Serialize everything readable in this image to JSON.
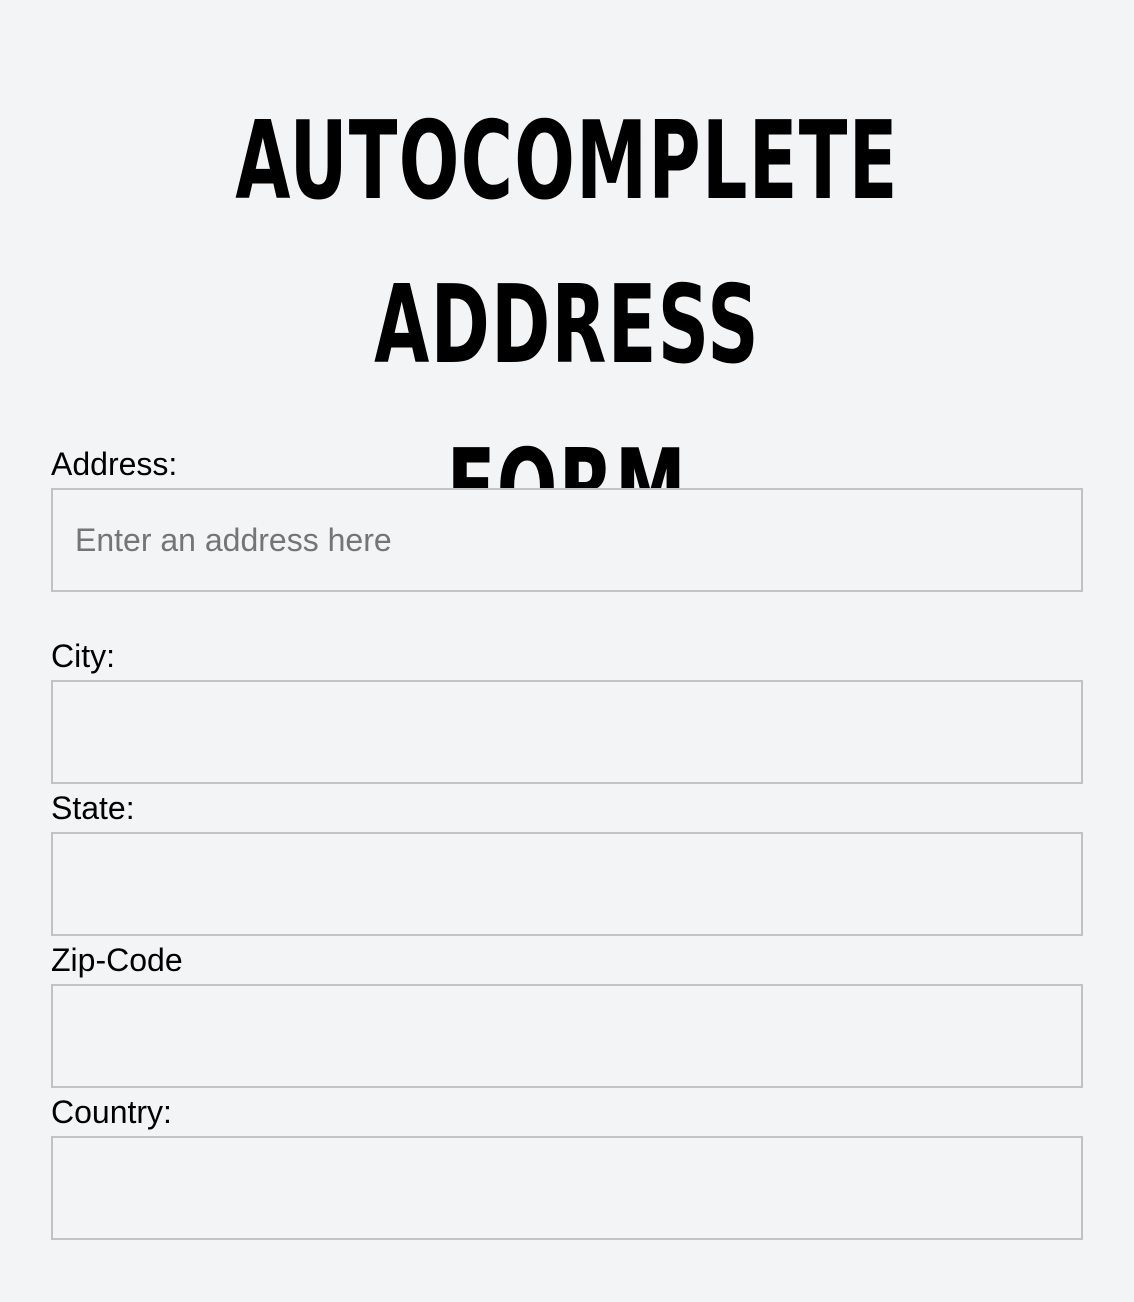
{
  "page": {
    "title_line1": "Autocomplete Address",
    "title_line2": "Form"
  },
  "form": {
    "address": {
      "label": "Address:",
      "placeholder": "Enter an address here",
      "value": ""
    },
    "city": {
      "label": "City:",
      "value": ""
    },
    "state": {
      "label": "State:",
      "value": ""
    },
    "zip": {
      "label": "Zip-Code",
      "value": ""
    },
    "country": {
      "label": "Country:",
      "value": ""
    }
  }
}
